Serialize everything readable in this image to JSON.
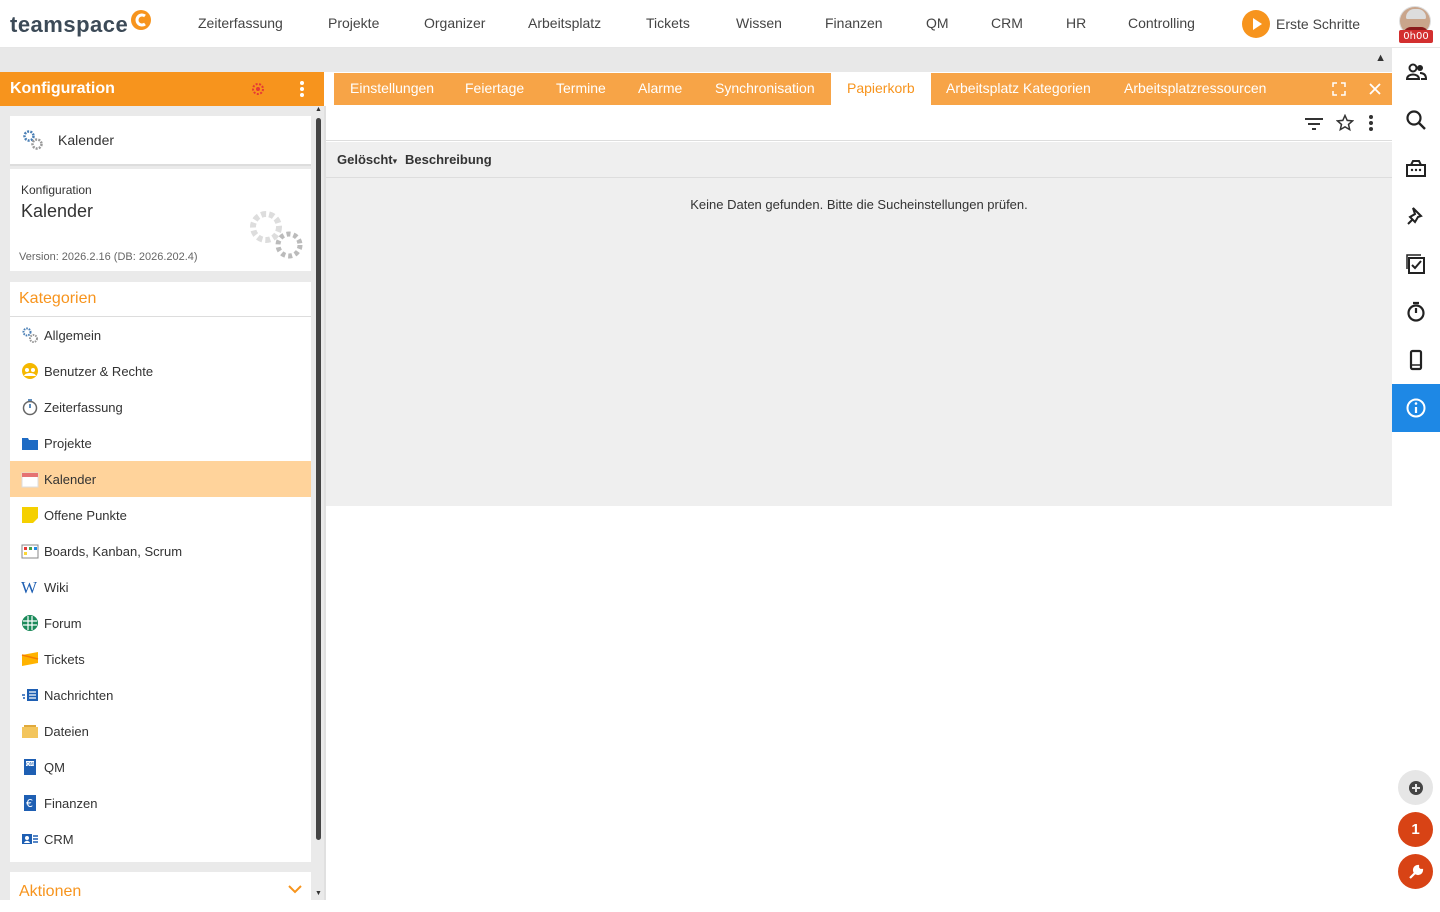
{
  "brand": {
    "logo_text": "teamspace",
    "accent": "#f7941d"
  },
  "topnav": [
    {
      "label": "Zeiterfassung"
    },
    {
      "label": "Projekte"
    },
    {
      "label": "Organizer"
    },
    {
      "label": "Arbeitsplatz"
    },
    {
      "label": "Tickets"
    },
    {
      "label": "Wissen"
    },
    {
      "label": "Finanzen"
    },
    {
      "label": "QM"
    },
    {
      "label": "CRM"
    },
    {
      "label": "HR"
    },
    {
      "label": "Controlling"
    }
  ],
  "erste_schritte": "Erste Schritte",
  "user": {
    "time_badge": "0h00"
  },
  "left_panel": {
    "title": "Konfiguration",
    "current_item": "Kalender",
    "info": {
      "sub": "Konfiguration",
      "title": "Kalender",
      "version": "Version: 2026.2.16 (DB: 2026.202.4)"
    },
    "categories_title": "Kategorien",
    "categories": [
      {
        "label": "Allgemein",
        "icon": "gears-icon"
      },
      {
        "label": "Benutzer & Rechte",
        "icon": "users-icon"
      },
      {
        "label": "Zeiterfassung",
        "icon": "stopwatch-icon"
      },
      {
        "label": "Projekte",
        "icon": "folder-icon"
      },
      {
        "label": "Kalender",
        "icon": "calendar-icon",
        "active": true
      },
      {
        "label": "Offene Punkte",
        "icon": "sticky-note-icon"
      },
      {
        "label": "Boards, Kanban, Scrum",
        "icon": "board-icon"
      },
      {
        "label": "Wiki",
        "icon": "wiki-icon"
      },
      {
        "label": "Forum",
        "icon": "forum-icon"
      },
      {
        "label": "Tickets",
        "icon": "ticket-icon"
      },
      {
        "label": "Nachrichten",
        "icon": "news-icon"
      },
      {
        "label": "Dateien",
        "icon": "files-icon"
      },
      {
        "label": "QM",
        "icon": "qm-icon"
      },
      {
        "label": "Finanzen",
        "icon": "euro-icon"
      },
      {
        "label": "CRM",
        "icon": "contact-card-icon"
      }
    ],
    "actions_title": "Aktionen"
  },
  "tabs": [
    {
      "label": "Einstellungen"
    },
    {
      "label": "Feiertage"
    },
    {
      "label": "Termine"
    },
    {
      "label": "Alarme"
    },
    {
      "label": "Synchronisation"
    },
    {
      "label": "Papierkorb",
      "active": true
    },
    {
      "label": "Arbeitsplatz Kategorien"
    },
    {
      "label": "Arbeitsplatzressourcen"
    }
  ],
  "table": {
    "columns": [
      "Gelöscht",
      "Beschreibung"
    ],
    "sort_indicator": "▾",
    "empty_message": "Keine Daten gefunden. Bitte die Sucheinstellungen prüfen."
  },
  "floating": {
    "notification_count": "1"
  }
}
